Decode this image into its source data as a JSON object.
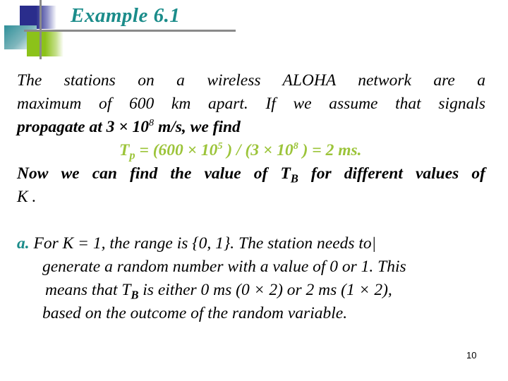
{
  "slide": {
    "title": "Example 6.1",
    "intro_line_1": "The stations on a wireless ALOHA network are a",
    "intro_line_2": "maximum of 600 km apart. If we assume that signals",
    "intro_line_3_pre": "propagate at 3 × 10",
    "intro_line_3_exp": "8",
    "intro_line_3_post": " m/s,  we find",
    "formula": {
      "lhs": "T",
      "lhs_sub": "p",
      "part1": " = (600 × 10",
      "exp1": "5",
      "part2": " ) / (3 × 10",
      "exp2": "8",
      "part3": " ) = 2 ms."
    },
    "now_line_1_pre": "Now we can find the value of T",
    "now_line_1_sub": "B",
    "now_line_1_post": " for different values of",
    "now_line_2": "K .",
    "item_a": {
      "label": "a.",
      "line_1": " For K = 1, the range is {0, 1}. The station needs to|",
      "line_2": "generate a random number with a value of 0 or 1. This",
      "line_3_pre": "means that T",
      "line_3_sub": "B",
      "line_3_post": " is either 0 ms (0 × 2) or 2 ms (1 × 2),",
      "line_4": "based on the outcome of the random variable."
    },
    "page_number": "10"
  },
  "colors": {
    "title": "#1b8c8a",
    "formula": "#9cc43a",
    "item_label": "#1b8c8a",
    "text": "#000000"
  }
}
